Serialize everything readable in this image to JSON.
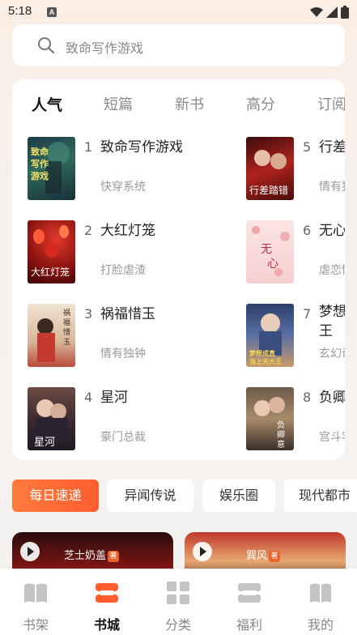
{
  "status_bar": {
    "time": "5:18",
    "notif_letter": "A"
  },
  "search": {
    "placeholder": "致命写作游戏"
  },
  "rank_tabs": [
    {
      "label": "人气",
      "active": true
    },
    {
      "label": "短篇",
      "active": false
    },
    {
      "label": "新书",
      "active": false
    },
    {
      "label": "高分",
      "active": false
    },
    {
      "label": "订阅",
      "active": false
    }
  ],
  "books": [
    {
      "rank": "1",
      "title": "致命写作游戏",
      "tag": "快穿系统",
      "cover_text": "致命写作游戏"
    },
    {
      "rank": "2",
      "title": "大红灯笼",
      "tag": "打脸虐渣",
      "cover_text": "大红灯笼"
    },
    {
      "rank": "3",
      "title": "祸福惜玉",
      "tag": "情有独钟",
      "cover_text": "祸福惜玉"
    },
    {
      "rank": "4",
      "title": "星河",
      "tag": "豪门总裁",
      "cover_text": "星河"
    },
    {
      "rank": "5",
      "title": "行差踏错",
      "tag": "情有独钟",
      "cover_text": "行差踏错"
    },
    {
      "rank": "6",
      "title": "无心",
      "tag": "虐恋情深",
      "cover_text": "无心"
    },
    {
      "rank": "7",
      "title": "梦想成真后我当上天大王",
      "tag": "玄幻奇幻",
      "cover_text": "梦想成真后我当上天大王"
    },
    {
      "rank": "8",
      "title": "负卿意",
      "tag": "宫斗宅斗",
      "cover_text": "负卿意"
    }
  ],
  "categories": [
    {
      "label": "每日速递",
      "active": true
    },
    {
      "label": "异闻传说",
      "active": false
    },
    {
      "label": "娱乐圈",
      "active": false
    },
    {
      "label": "现代都市",
      "active": false
    }
  ],
  "videos": [
    {
      "author": "芝士奶盖",
      "badge": "著"
    },
    {
      "author": "巽风",
      "badge": "著"
    }
  ],
  "nav": [
    {
      "label": "书架",
      "icon": "book-open-icon",
      "active": false
    },
    {
      "label": "书城",
      "icon": "store-icon",
      "active": true
    },
    {
      "label": "分类",
      "icon": "grid-icon",
      "active": false
    },
    {
      "label": "福利",
      "icon": "gift-icon",
      "active": false
    },
    {
      "label": "我的",
      "icon": "profile-book-icon",
      "active": false
    }
  ],
  "colors": {
    "accent": "#ff5d2e",
    "accent_light": "#ff7a3d"
  }
}
